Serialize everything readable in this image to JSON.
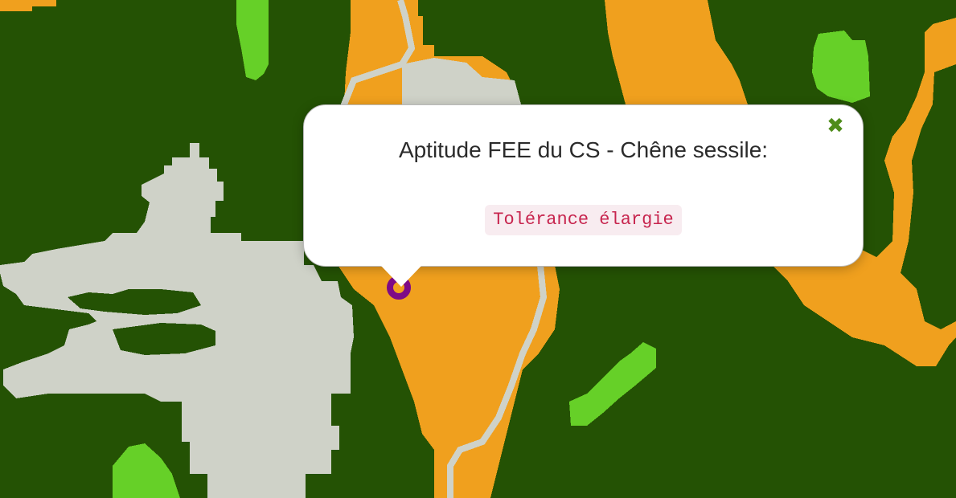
{
  "map": {
    "colors": {
      "forest": "#245204",
      "orange": "#f0a01e",
      "grey": "#cfd2c8",
      "lightgreen": "#66d028",
      "marker": "#7e0a86"
    },
    "marker_icon": "location-ring-icon"
  },
  "popup": {
    "title": "Aptitude FEE du CS - Chêne sessile:",
    "value": "Tolérance élargie",
    "close_icon": "close-x-icon",
    "close_color": "#4e8c1a",
    "value_color": "#c7254e",
    "value_background": "#f8ecf0"
  }
}
